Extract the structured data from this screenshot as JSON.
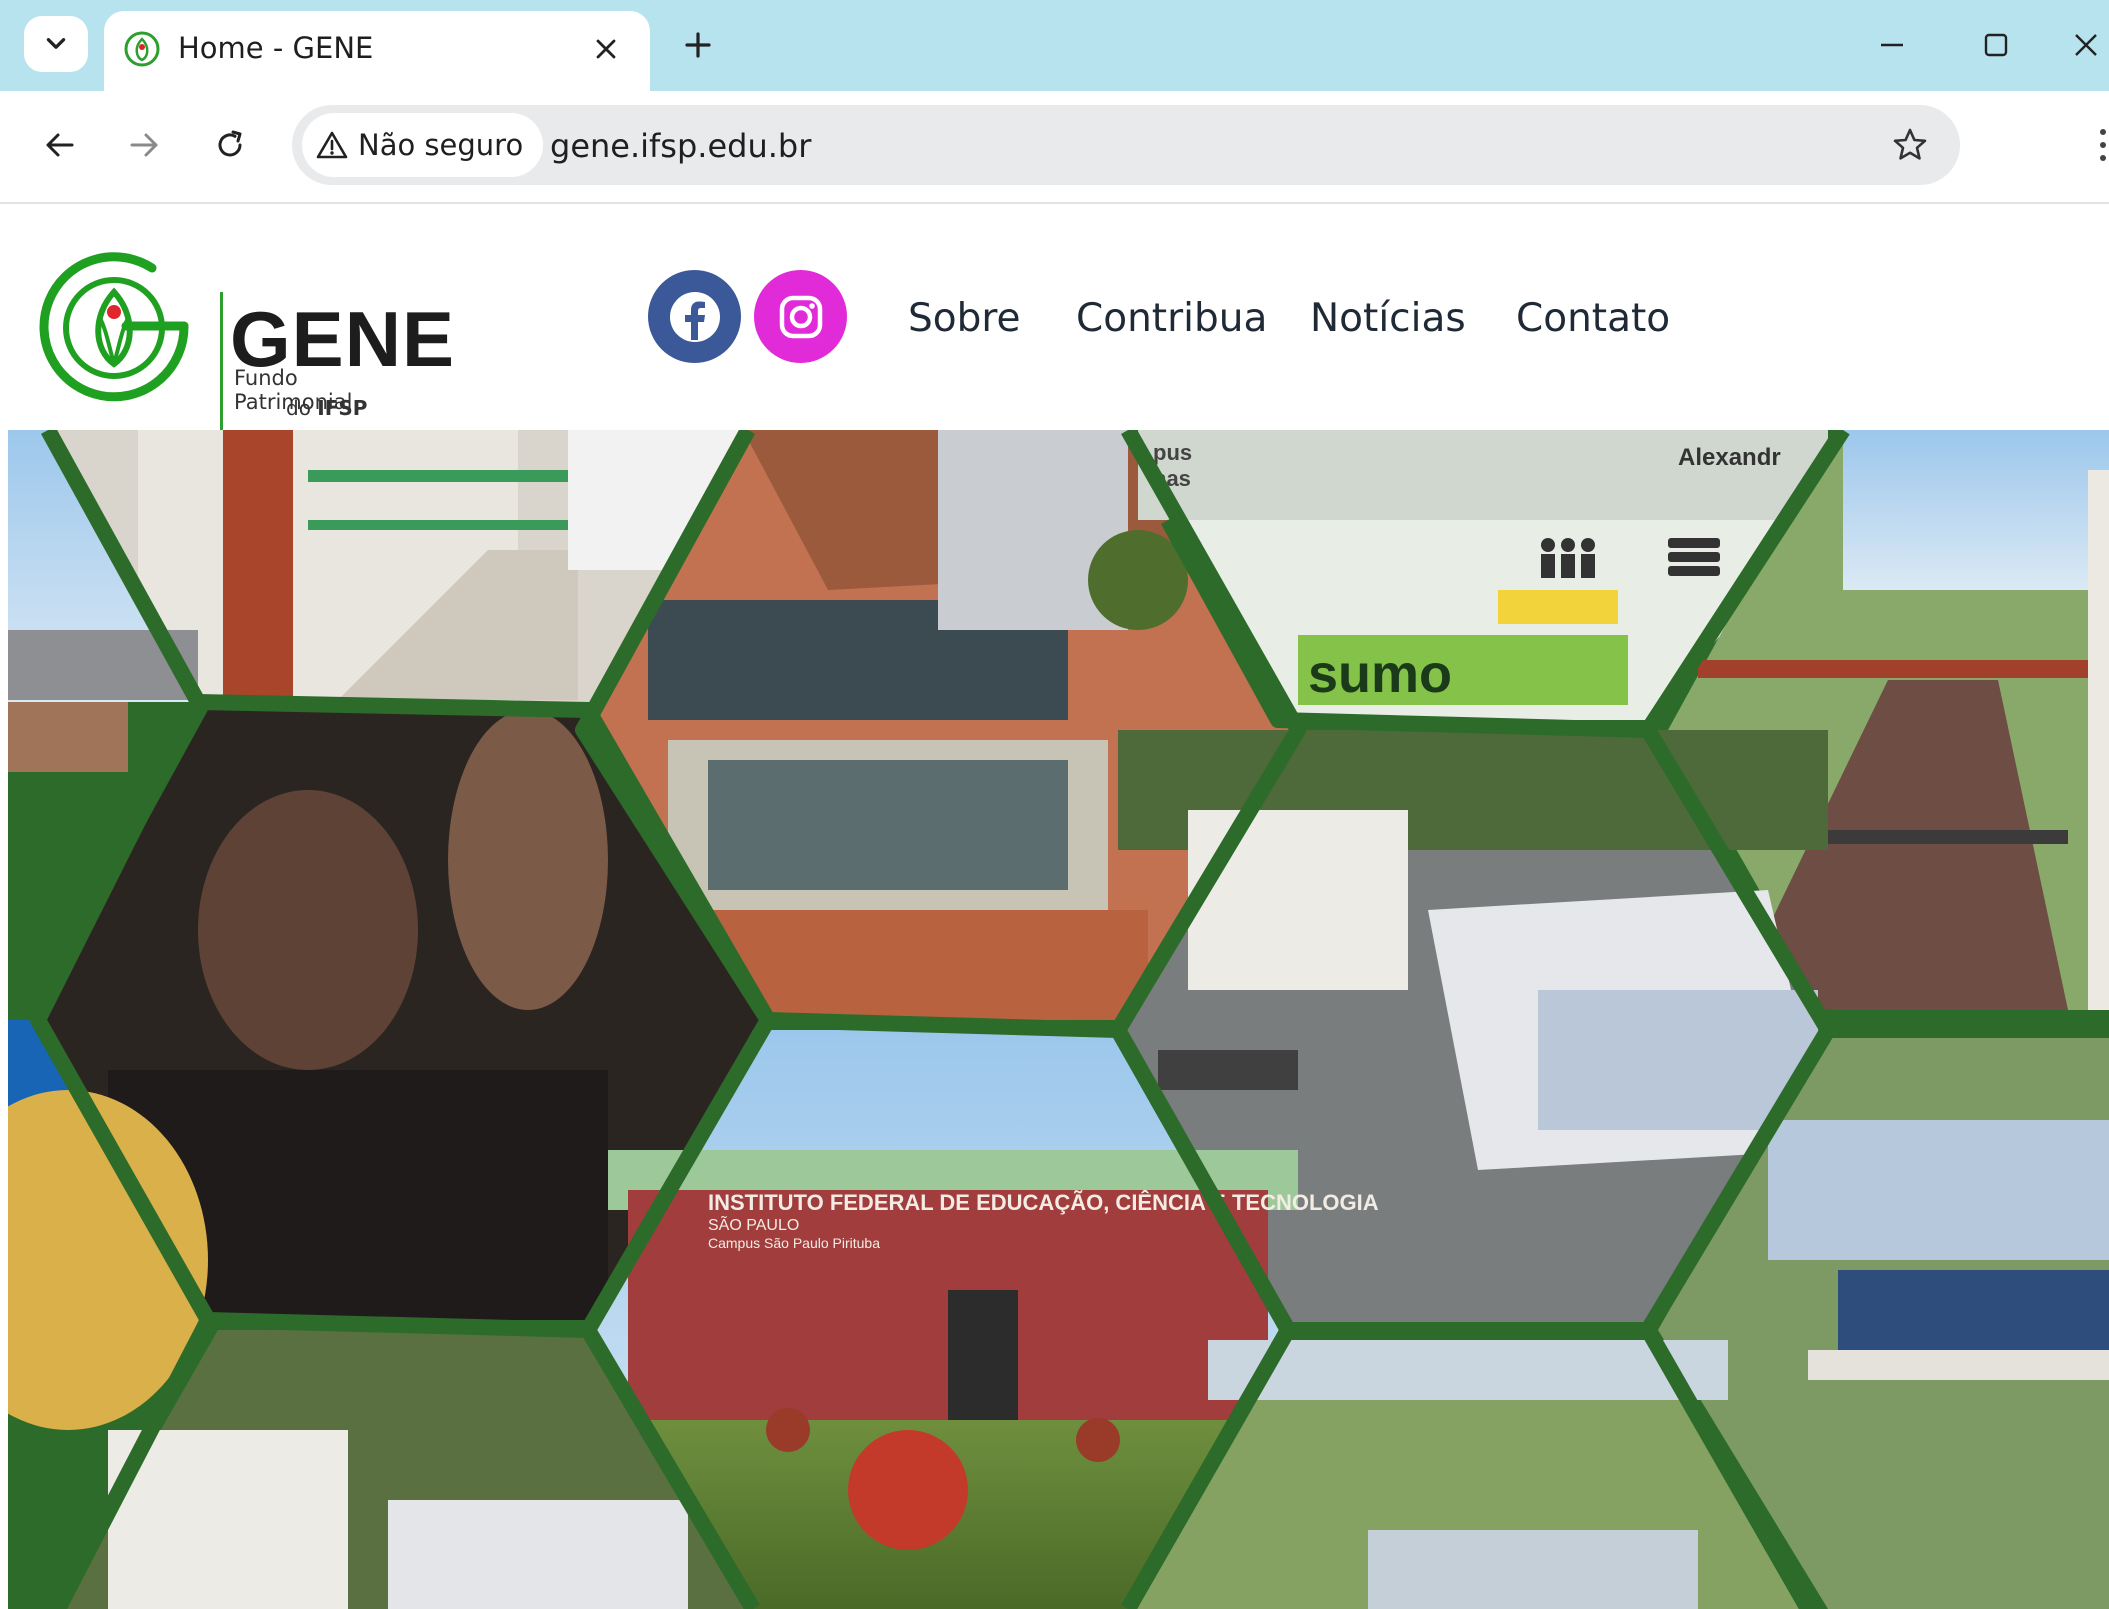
{
  "browser": {
    "tab_title": "Home - GENE",
    "security_label": "Não seguro",
    "url": "gene.ifsp.edu.br"
  },
  "site": {
    "logo": {
      "name": "GENE",
      "subtitle_line1": "Fundo Patrimonial",
      "subtitle_line2_prefix": "do ",
      "subtitle_line2_bold": "IFSP"
    },
    "social": [
      {
        "icon": "facebook-icon",
        "color": "#3b5998"
      },
      {
        "icon": "instagram-icon",
        "color": "#e22bd8"
      }
    ],
    "nav": [
      "Sobre",
      "Contribua",
      "Notícias",
      "Contato"
    ]
  },
  "hero": {
    "sign_line1": "INSTITUTO FEDERAL DE EDUCAÇÃO, CIÊNCIA E TECNOLOGIA",
    "sign_line2": "SÃO PAULO",
    "sign_line3": "Campus São Paulo Pirituba",
    "poster_line1": "Alexandr",
    "poster_line2": "pus",
    "poster_line3": "nas",
    "poster_word": "sumo"
  },
  "colors": {
    "tabbar": "#b7e3ee",
    "brand_green": "#2e9e2e",
    "honeycomb_border": "#2d6b2a"
  }
}
